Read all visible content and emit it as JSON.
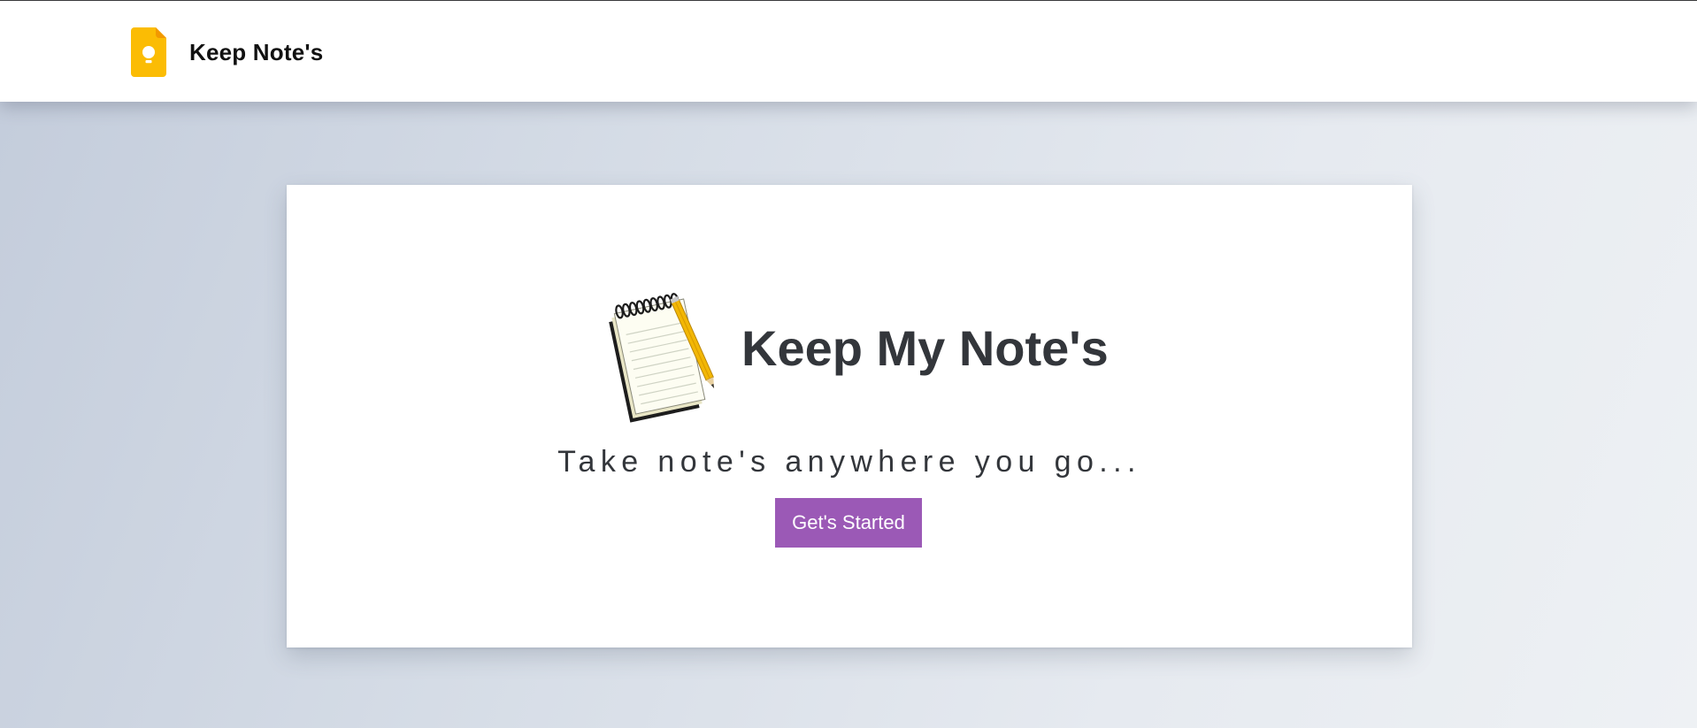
{
  "navbar": {
    "brand_name": "Keep Note's",
    "brand_icon": "keep-notes-logo-icon",
    "brand_color": "#fbbc04"
  },
  "hero": {
    "icon": "notepad-with-pencil-icon",
    "title": "Keep My Note's",
    "tagline": "Take note's anywhere you go...",
    "cta_label": "Get's Started",
    "cta_color": "#9b59b6"
  }
}
